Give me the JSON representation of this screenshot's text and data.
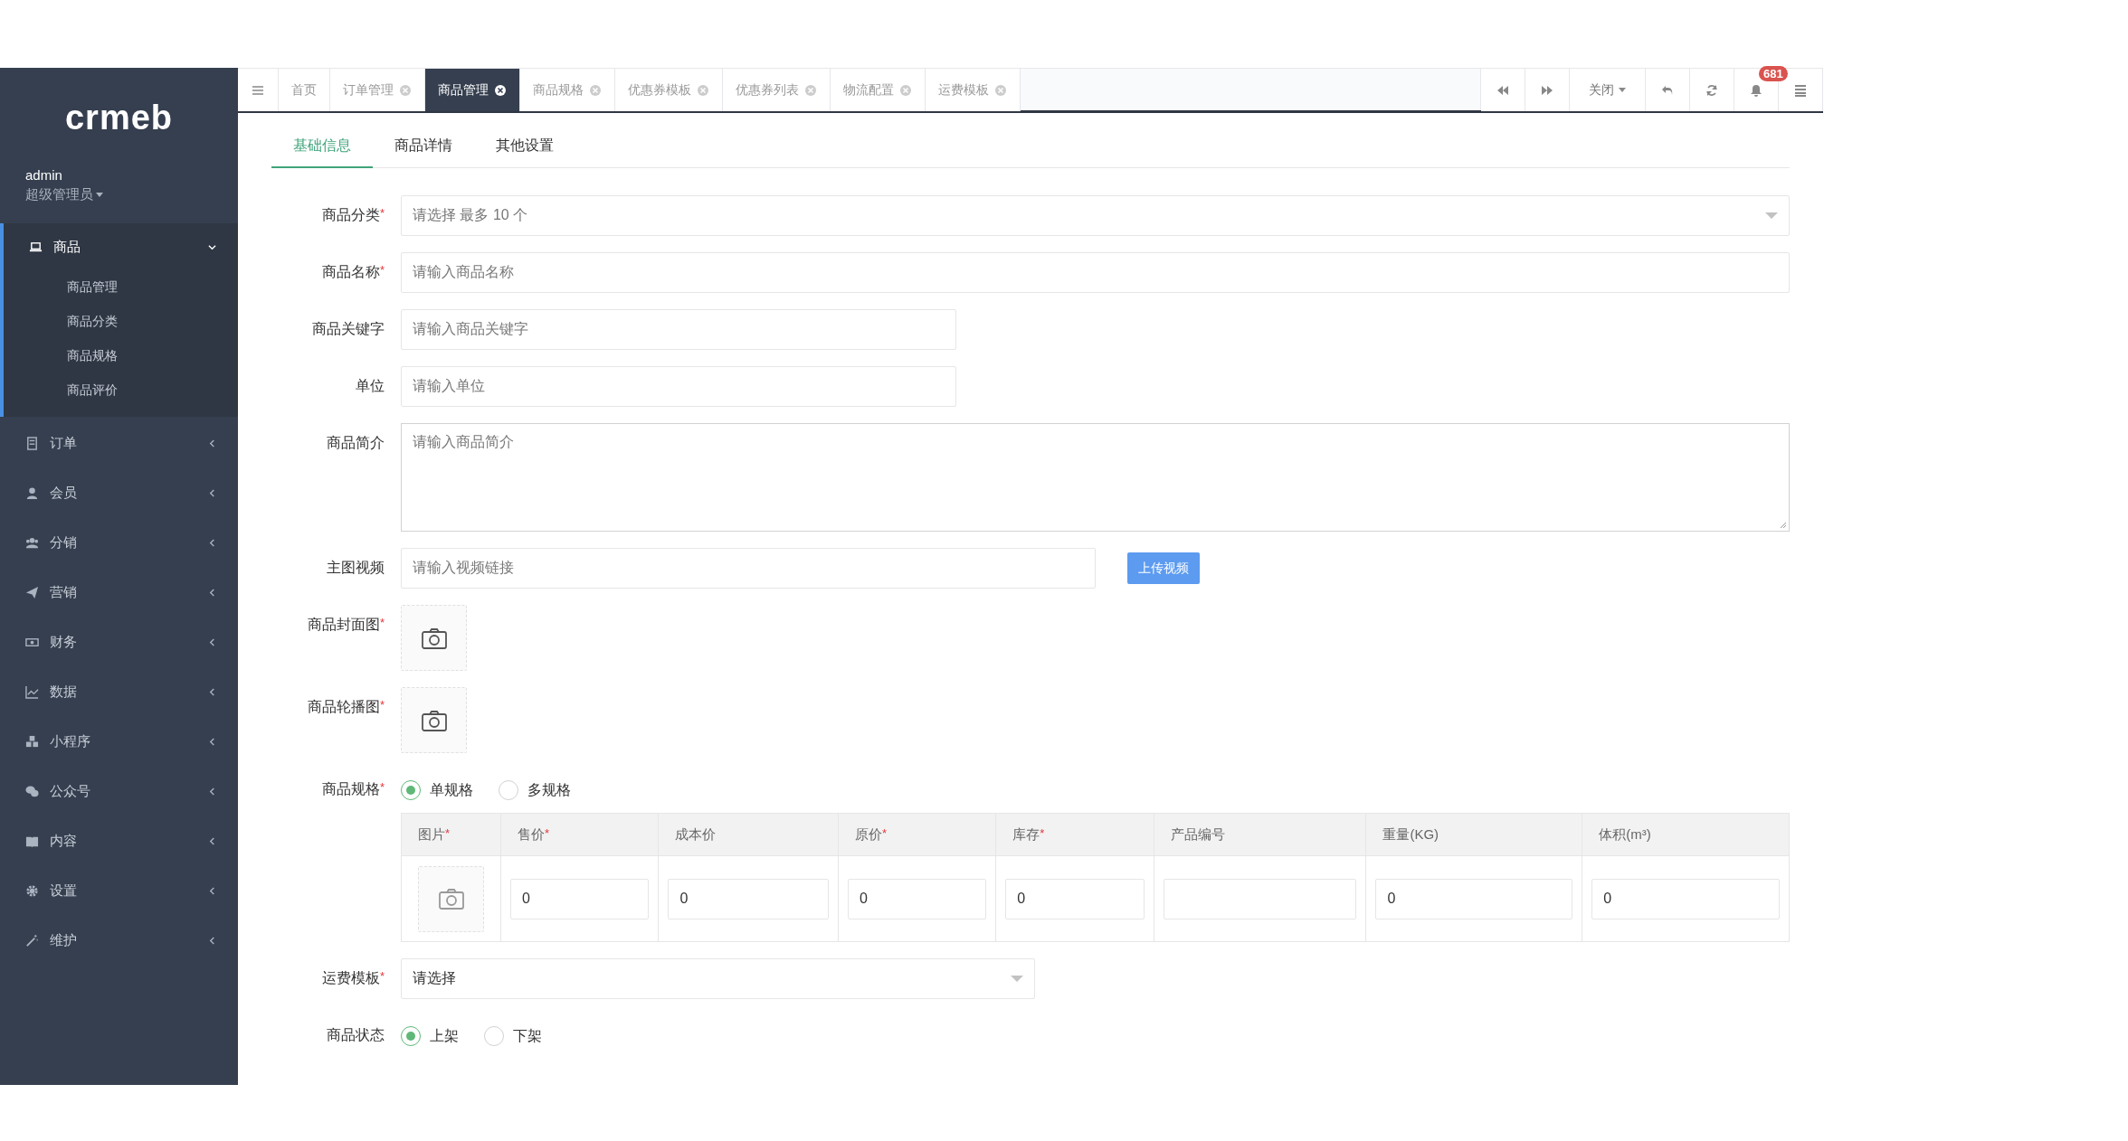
{
  "sidebar": {
    "logo": "crmeb",
    "user": {
      "name": "admin",
      "role": "超级管理员"
    },
    "menu": [
      {
        "label": "商品",
        "expanded": true,
        "children": [
          {
            "label": "商品管理"
          },
          {
            "label": "商品分类"
          },
          {
            "label": "商品规格"
          },
          {
            "label": "商品评价"
          }
        ]
      },
      {
        "label": "订单",
        "expanded": false
      },
      {
        "label": "会员",
        "expanded": false
      },
      {
        "label": "分销",
        "expanded": false
      },
      {
        "label": "营销",
        "expanded": false
      },
      {
        "label": "财务",
        "expanded": false
      },
      {
        "label": "数据",
        "expanded": false
      },
      {
        "label": "小程序",
        "expanded": false
      },
      {
        "label": "公众号",
        "expanded": false
      },
      {
        "label": "内容",
        "expanded": false
      },
      {
        "label": "设置",
        "expanded": false
      },
      {
        "label": "维护",
        "expanded": false
      }
    ]
  },
  "page_tabs": [
    {
      "label": "首页",
      "selected": false,
      "closable": false
    },
    {
      "label": "订单管理",
      "selected": false,
      "closable": true
    },
    {
      "label": "商品管理",
      "selected": true,
      "closable": true
    },
    {
      "label": "商品规格",
      "selected": false,
      "closable": true
    },
    {
      "label": "优惠券模板",
      "selected": false,
      "closable": true
    },
    {
      "label": "优惠券列表",
      "selected": false,
      "closable": true
    },
    {
      "label": "物流配置",
      "selected": false,
      "closable": true
    },
    {
      "label": "运费模板",
      "selected": false,
      "closable": true
    }
  ],
  "toolbar": {
    "close_menu": "关闭",
    "notification_count": "681"
  },
  "form_tabs": [
    {
      "label": "基础信息",
      "selected": true
    },
    {
      "label": "商品详情",
      "selected": false
    },
    {
      "label": "其他设置",
      "selected": false
    }
  ],
  "form": [
    {
      "kind": "select",
      "label": "商品分类",
      "required_mark": "*",
      "placeholder": "请选择 最多 10 个"
    },
    {
      "kind": "input",
      "label": "商品名称",
      "required_mark": "*",
      "placeholder": "请输入商品名称"
    },
    {
      "kind": "short-input",
      "label": "商品关键字",
      "placeholder": "请输入商品关键字"
    },
    {
      "kind": "short-input",
      "label": "单位",
      "placeholder": "请输入单位"
    },
    {
      "kind": "textarea",
      "label": "商品简介",
      "placeholder": "请输入商品简介"
    },
    {
      "kind": "video",
      "label": "主图视频",
      "placeholder": "请输入视频链接",
      "button": "上传视频"
    },
    {
      "kind": "upload",
      "label": "商品封面图",
      "required_mark": "*"
    },
    {
      "kind": "upload",
      "label": "商品轮播图",
      "required_mark": "*"
    },
    {
      "kind": "radio",
      "label": "商品规格",
      "required_mark": "*",
      "options": [
        {
          "label": "单规格",
          "selected": true
        },
        {
          "label": "多规格",
          "selected": false
        }
      ]
    },
    {
      "kind": "table",
      "columns": [
        {
          "label": "图片",
          "required_mark": "*"
        },
        {
          "label": "售价",
          "required_mark": "*"
        },
        {
          "label": "成本价"
        },
        {
          "label": "原价",
          "required_mark": "*"
        },
        {
          "label": "库存",
          "required_mark": "*"
        },
        {
          "label": "产品编号"
        },
        {
          "label": "重量(KG)"
        },
        {
          "label": "体积(m³)"
        }
      ],
      "rows": [
        [
          {
            "kind": "image"
          },
          {
            "kind": "input",
            "value": "0"
          },
          {
            "kind": "input",
            "value": "0"
          },
          {
            "kind": "input",
            "value": "0"
          },
          {
            "kind": "input",
            "value": "0"
          },
          {
            "kind": "input"
          },
          {
            "kind": "input",
            "value": "0"
          },
          {
            "kind": "input",
            "value": "0"
          }
        ]
      ]
    },
    {
      "kind": "short-select",
      "label": "运费模板",
      "required_mark": "*",
      "value": "请选择"
    },
    {
      "kind": "radio",
      "label": "商品状态",
      "options": [
        {
          "label": "上架",
          "selected": true
        },
        {
          "label": "下架",
          "selected": false
        }
      ]
    }
  ]
}
